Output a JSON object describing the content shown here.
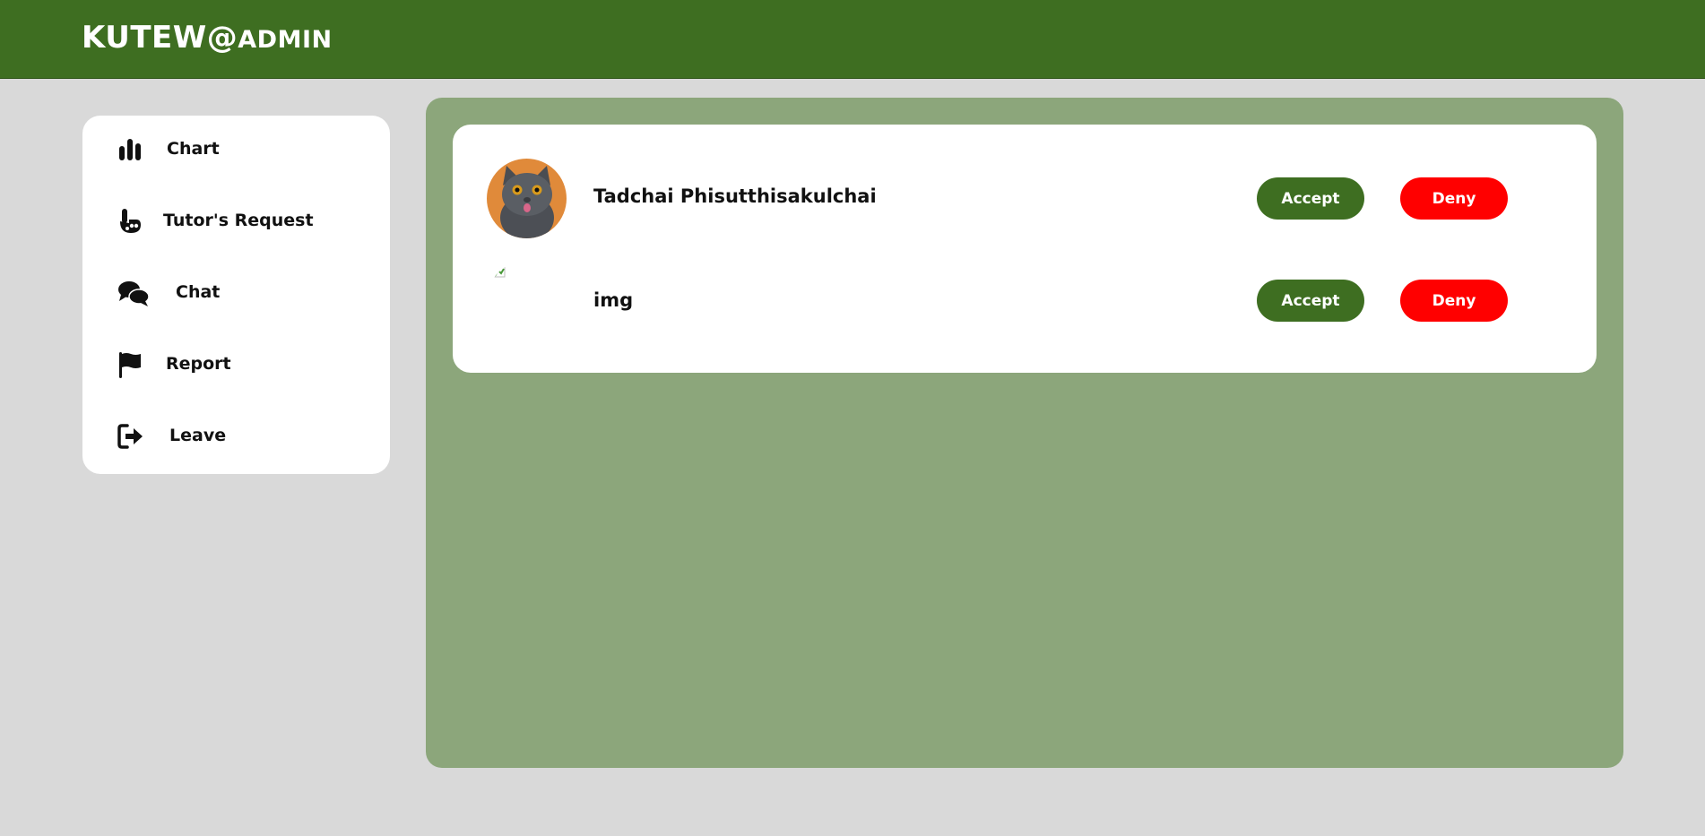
{
  "header": {
    "brand_main": "KUTEW@",
    "brand_sub": "ADMIN",
    "bg_color": "#3e6e21"
  },
  "sidebar": {
    "items": [
      {
        "label": "Chart",
        "icon": "bar-chart-icon"
      },
      {
        "label": "Tutor's Request",
        "icon": "hand-pointer-icon"
      },
      {
        "label": "Chat",
        "icon": "chat-bubbles-icon"
      },
      {
        "label": "Report",
        "icon": "flag-icon"
      },
      {
        "label": "Leave",
        "icon": "logout-icon"
      }
    ]
  },
  "requests": [
    {
      "name": "Tadchai Phisutthisakulchai",
      "avatar": "cat-avatar",
      "accept_label": "Accept",
      "deny_label": "Deny"
    },
    {
      "name": "img",
      "avatar": "broken-image-icon",
      "accept_label": "Accept",
      "deny_label": "Deny"
    }
  ],
  "colors": {
    "accent": "#3e6e21",
    "deny": "#ff0000",
    "panel": "#8ca67b",
    "page_bg": "#d9d9d9"
  }
}
